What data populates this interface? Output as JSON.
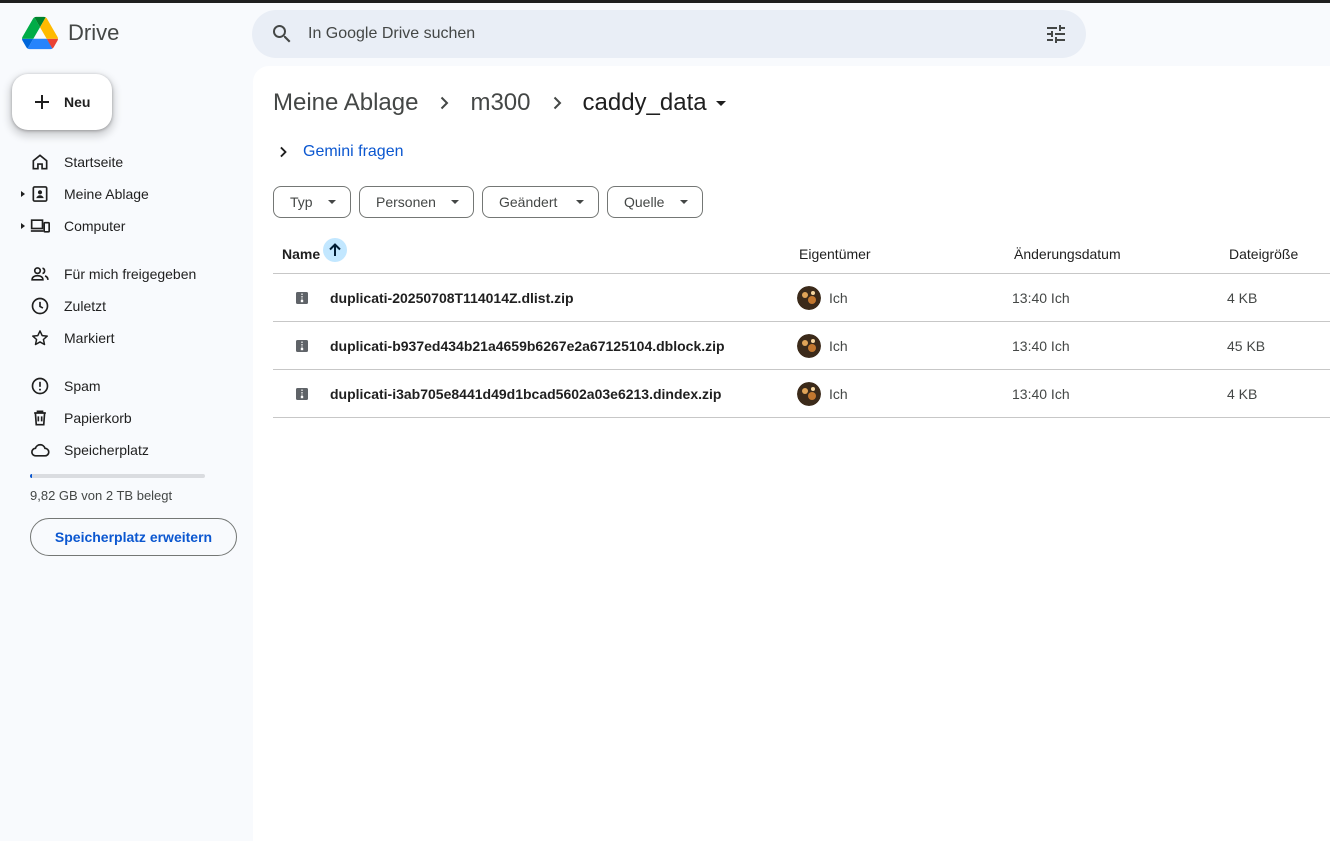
{
  "app": {
    "brand": "Drive"
  },
  "search": {
    "placeholder": "In Google Drive suchen"
  },
  "sidebar": {
    "new_label": "Neu",
    "items": [
      {
        "label": "Startseite",
        "icon": "home-icon"
      },
      {
        "label": "Meine Ablage",
        "icon": "my-drive-icon"
      },
      {
        "label": "Computer",
        "icon": "computer-icon"
      },
      {
        "label": "Für mich freigegeben",
        "icon": "shared-people-icon"
      },
      {
        "label": "Zuletzt",
        "icon": "clock-icon"
      },
      {
        "label": "Markiert",
        "icon": "star-icon"
      },
      {
        "label": "Spam",
        "icon": "spam-icon"
      },
      {
        "label": "Papierkorb",
        "icon": "trash-icon"
      },
      {
        "label": "Speicherplatz",
        "icon": "cloud-icon"
      }
    ],
    "storage_text": "9,82 GB von 2 TB belegt",
    "storage_fraction": 0.005,
    "storage_button": "Speicherplatz erweitern"
  },
  "breadcrumb": [
    "Meine Ablage",
    "m300",
    "caddy_data"
  ],
  "gemini_label": "Gemini fragen",
  "filters": [
    "Typ",
    "Personen",
    "Geändert",
    "Quelle"
  ],
  "table": {
    "headers": {
      "name": "Name",
      "owner": "Eigentümer",
      "modified": "Änderungsdatum",
      "size": "Dateigröße"
    },
    "rows": [
      {
        "name": "duplicati-20250708T114014Z.dlist.zip",
        "owner": "Ich",
        "modified": "13:40 Ich",
        "size": "4 KB"
      },
      {
        "name": "duplicati-b937ed434b21a4659b6267e2a67125104.dblock.zip",
        "owner": "Ich",
        "modified": "13:40 Ich",
        "size": "45 KB"
      },
      {
        "name": "duplicati-i3ab705e8441d49d1bcad5602a03e6213.dindex.zip",
        "owner": "Ich",
        "modified": "13:40 Ich",
        "size": "4 KB"
      }
    ]
  },
  "colors": {
    "accent": "#0b57d0",
    "sidebar_bg": "#f8fafd",
    "search_bg": "#e9eef6",
    "sort_bg": "#c2e7ff"
  }
}
